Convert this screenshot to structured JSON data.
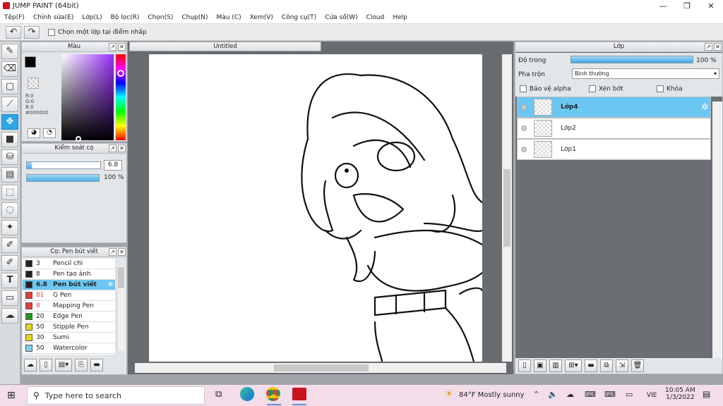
{
  "app": {
    "title": "JUMP PAINT (64bit)",
    "win_min": "—",
    "win_max": "❐",
    "win_close": "✕"
  },
  "menu": [
    "Tệp(F)",
    "Chỉnh sửa(E)",
    "Lớp(L)",
    "Bộ lọc(R)",
    "Chọn(S)",
    "Chụp(N)",
    "Màu (C)",
    "Xem(V)",
    "Công cụ(T)",
    "Cửa sổ(W)",
    "Cloud",
    "Help"
  ],
  "toolbar": {
    "undo": "↶",
    "redo": "↷",
    "select_layer_label": "Chọn một lớp tại điểm nhấp"
  },
  "color_panel": {
    "title": "Màu",
    "r": "R:0",
    "g": "G:0",
    "b": "B:0",
    "hex": "#000000"
  },
  "brush_panel": {
    "title": "Kiểm soát cọ",
    "size": "6.8",
    "opacity": "100 %",
    "size_fill": 0.07,
    "opacity_fill": 1.0
  },
  "pen_panel": {
    "title": "Cọ: Pen bút viết",
    "items": [
      {
        "size": "3",
        "name": "Pencil chì",
        "color": "#222222"
      },
      {
        "size": "8",
        "name": "Pen tạo ảnh",
        "color": "#222222"
      },
      {
        "size": "6.8",
        "name": "Pen bút viết",
        "color": "#222222",
        "selected": true
      },
      {
        "size": "81",
        "name": "G Pen",
        "color": "#e83a3a"
      },
      {
        "size": "8",
        "name": "Mapping Pen",
        "color": "#e83a3a"
      },
      {
        "size": "20",
        "name": "Edge Pen",
        "color": "#1f9a1f"
      },
      {
        "size": "50",
        "name": "Stipple Pen",
        "color": "#e8d81a"
      },
      {
        "size": "30",
        "name": "Sumi",
        "color": "#e8d81a"
      },
      {
        "size": "50",
        "name": "Watercolor",
        "color": "#7fd0f0"
      }
    ]
  },
  "canvas": {
    "tab": "Untitled"
  },
  "layer_panel": {
    "title": "Lớp",
    "opacity_label": "Độ trong",
    "opacity_value": "100 %",
    "blend_label": "Pha trộn",
    "blend_value": "Bình thường",
    "protect_alpha": "Bảo vệ alpha",
    "clipping": "Xén bớt",
    "lock": "Khóa",
    "layers": [
      {
        "name": "Lớp4",
        "selected": true
      },
      {
        "name": "Lớp2"
      },
      {
        "name": "Lớp1"
      }
    ]
  },
  "taskbar": {
    "search_placeholder": "Type here to search",
    "weather": "84°F  Mostly sunny",
    "lang": "VIE",
    "time": "10:05 AM",
    "date": "1/3/2022"
  }
}
